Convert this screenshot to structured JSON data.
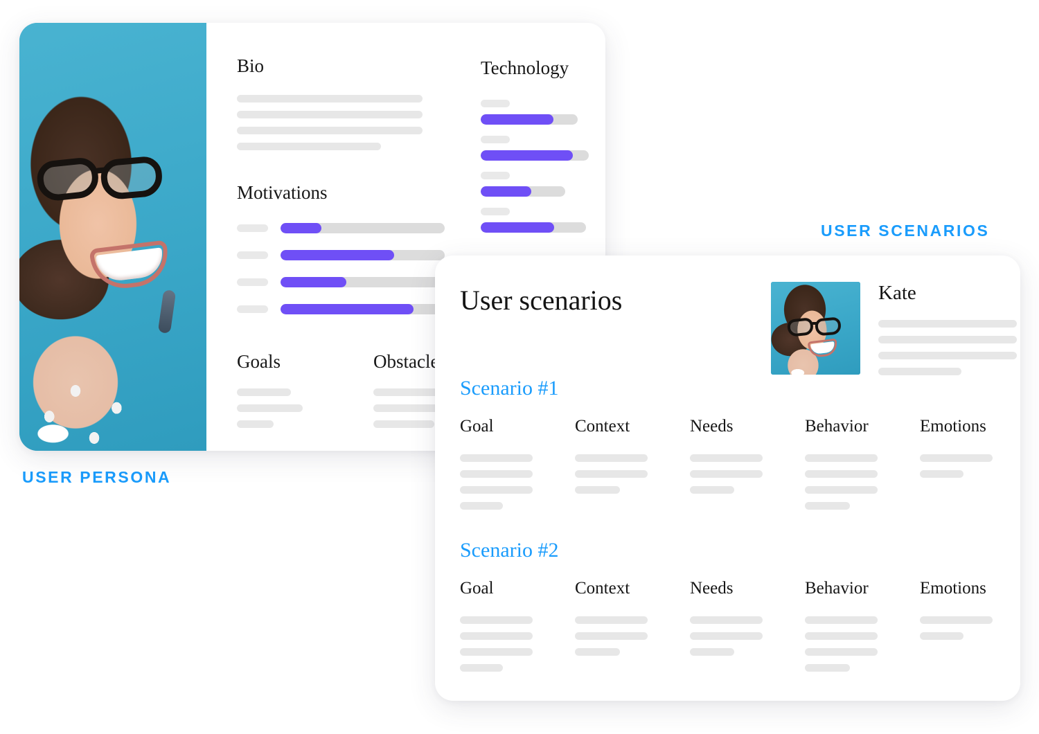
{
  "captions": {
    "persona": "USER PERSONA",
    "scenarios": "USER SCENARIOS"
  },
  "colors": {
    "accent_blue": "#1A9CFC",
    "bar_purple": "#6F4FF6",
    "bar_track": "#DCDCDC",
    "skeleton": "#E7E7E7",
    "photo_background": "#3FAECE",
    "card_background": "#FFFFFF"
  },
  "persona_card": {
    "photo": {
      "alt": "smiling-woman-with-glasses-photo"
    },
    "bio": {
      "title": "Bio",
      "lines": [
        268,
        268,
        268,
        208
      ]
    },
    "technology": {
      "title": "Technology",
      "items": [
        {
          "label_width": 42,
          "track_width": 140,
          "fill_percent": 75
        },
        {
          "label_width": 42,
          "track_width": 156,
          "fill_percent": 85
        },
        {
          "label_width": 42,
          "track_width": 122,
          "fill_percent": 60
        },
        {
          "label_width": 42,
          "track_width": 152,
          "fill_percent": 70
        }
      ]
    },
    "motivations": {
      "title": "Motivations",
      "items": [
        {
          "fill_percent": 25
        },
        {
          "fill_percent": 69
        },
        {
          "fill_percent": 40
        },
        {
          "fill_percent": 81
        }
      ]
    },
    "goals": {
      "title": "Goals",
      "lines": [
        78,
        95,
        53
      ]
    },
    "obstacles": {
      "title": "Obstacles",
      "lines": [
        108,
        135,
        88
      ]
    }
  },
  "scenarios_card": {
    "title": "User scenarios",
    "persona_name": "Kate",
    "persona_lines": [
      200,
      200,
      200,
      120
    ],
    "scenarios": [
      {
        "heading": "Scenario #1",
        "columns": [
          {
            "header": "Goal",
            "lines": [
              105,
              105,
              105,
              62
            ]
          },
          {
            "header": "Context",
            "lines": [
              105,
              105,
              65
            ]
          },
          {
            "header": "Needs",
            "lines": [
              105,
              105,
              64
            ]
          },
          {
            "header": "Behavior",
            "lines": [
              105,
              105,
              105,
              65
            ]
          },
          {
            "header": "Emotions",
            "lines": [
              105,
              63
            ]
          }
        ]
      },
      {
        "heading": "Scenario #2",
        "columns": [
          {
            "header": "Goal",
            "lines": [
              105,
              105,
              105,
              62
            ]
          },
          {
            "header": "Context",
            "lines": [
              105,
              105,
              65
            ]
          },
          {
            "header": "Needs",
            "lines": [
              105,
              105,
              64
            ]
          },
          {
            "header": "Behavior",
            "lines": [
              105,
              105,
              105,
              65
            ]
          },
          {
            "header": "Emotions",
            "lines": [
              105,
              63
            ]
          }
        ]
      }
    ]
  }
}
